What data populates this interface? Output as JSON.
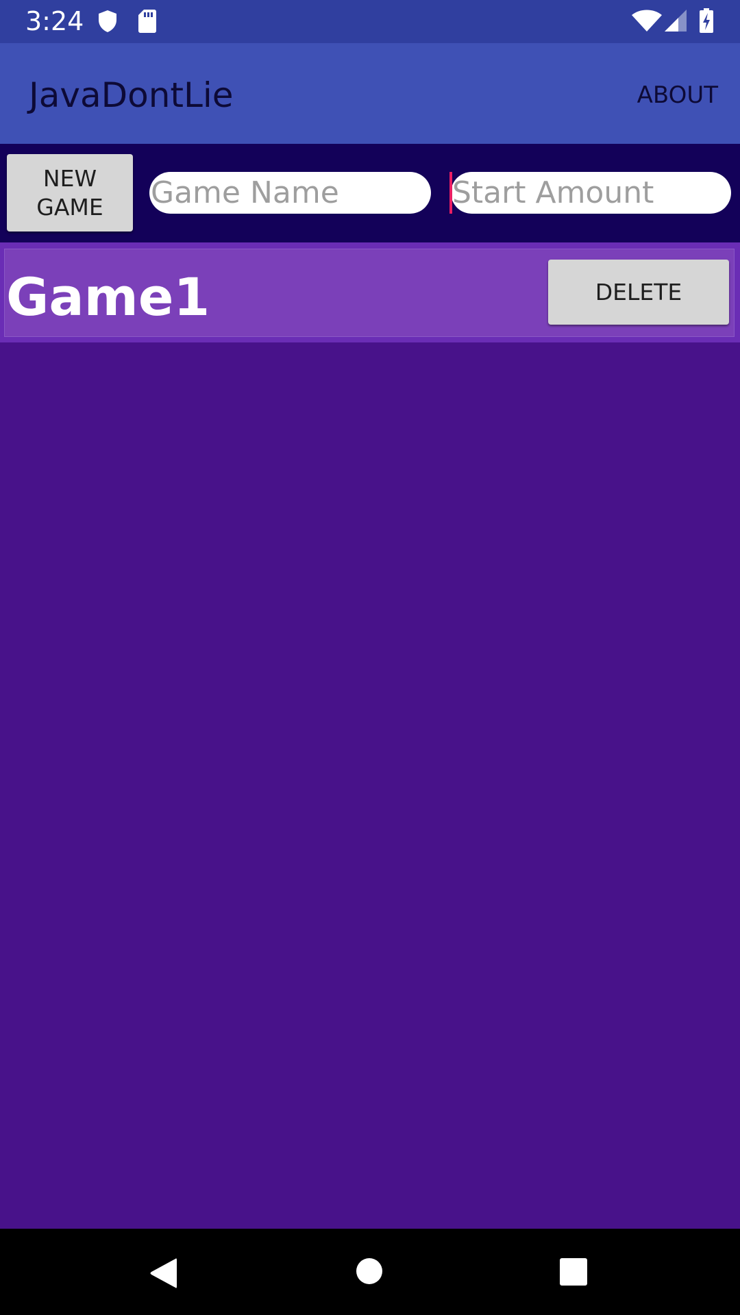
{
  "status_bar": {
    "time": "3:24",
    "icons": [
      "shield-icon",
      "sd-card-icon",
      "wifi-icon",
      "cellular-signal-icon",
      "battery-charging-icon"
    ]
  },
  "app_bar": {
    "title": "JavaDontLie",
    "about_label": "ABOUT"
  },
  "toolbar": {
    "new_game_label": "NEW\nGAME",
    "game_name_placeholder": "Game Name",
    "start_amount_placeholder": "Start Amount"
  },
  "games": [
    {
      "name": "Game1",
      "delete_label": "DELETE"
    }
  ],
  "nav_bar": {
    "icons": [
      "back-icon",
      "home-icon",
      "recents-icon"
    ]
  },
  "colors": {
    "status_bar": "#303f9f",
    "app_bar": "#3f51b5",
    "toolbar": "#130159",
    "background": "#48128a",
    "game_row": "#7b40b9",
    "cursor": "#e91e63"
  }
}
